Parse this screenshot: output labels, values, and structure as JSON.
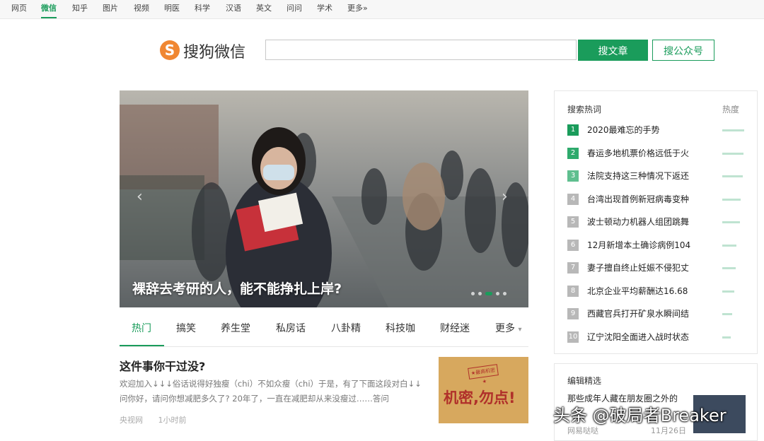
{
  "nav": {
    "items": [
      "网页",
      "微信",
      "知乎",
      "图片",
      "视频",
      "明医",
      "科学",
      "汉语",
      "英文",
      "问问",
      "学术",
      "更多»"
    ],
    "active": "微信"
  },
  "logo": {
    "mark": "S",
    "text": "搜狗微信"
  },
  "search": {
    "value": "",
    "button_article": "搜文章",
    "button_account": "搜公众号"
  },
  "carousel": {
    "caption": "裸辞去考研的人，能不能挣扎上岸?",
    "prev_icon": "‹",
    "next_icon": "›",
    "dots": 5,
    "active_dot": 3
  },
  "tabs": {
    "items": [
      "热门",
      "搞笑",
      "养生堂",
      "私房话",
      "八卦精",
      "科技咖",
      "财经迷",
      "更多"
    ],
    "more_icon": "▾"
  },
  "article": {
    "title": "这件事你干过没?",
    "summary": "欢迎加入↓↓↓俗话说得好独瘦（chi）不如众瘦（chi）于是，有了下面这段对白↓↓问你好，请问你想减肥多久了? 20年了，一直在减肥却从来没瘦过……答问",
    "source": "央视网",
    "time": "1小时前",
    "thumb_stamp": "★最高机密★",
    "thumb_text": "机密,勿点!"
  },
  "hot": {
    "header": "搜索热词",
    "heat_label": "热度",
    "items": [
      {
        "rank": "1",
        "title": "2020最难忘的手势",
        "heat": 1.0
      },
      {
        "rank": "2",
        "title": "春运多地机票价格远低于火",
        "heat": 0.97
      },
      {
        "rank": "3",
        "title": "法院支持这三种情况下返还",
        "heat": 0.93
      },
      {
        "rank": "4",
        "title": "台湾出现首例新冠病毒变种",
        "heat": 0.85
      },
      {
        "rank": "5",
        "title": "波士顿动力机器人组团跳舞",
        "heat": 0.8
      },
      {
        "rank": "6",
        "title": "12月新增本土确诊病例104",
        "heat": 0.66
      },
      {
        "rank": "7",
        "title": "妻子擅自终止妊娠不侵犯丈",
        "heat": 0.6
      },
      {
        "rank": "8",
        "title": "北京企业平均薪酬达16.68",
        "heat": 0.55
      },
      {
        "rank": "9",
        "title": "西藏官兵打开矿泉水瞬间结",
        "heat": 0.45
      },
      {
        "rank": "10",
        "title": "辽宁沈阳全面进入战时状态",
        "heat": 0.4
      }
    ],
    "rank_colors": [
      "#1a9c5b",
      "#2eaa6c",
      "#5fbf8f",
      "#b8b8b8"
    ]
  },
  "picks": {
    "header": "编辑精选",
    "title": "那些成年人藏在朋友圈之外的",
    "source": "网易哒哒",
    "time": "11月26日"
  },
  "watermark": "头条 @破局者Breaker",
  "colors": {
    "accent": "#1a9c5b",
    "logo": "#f08732"
  }
}
